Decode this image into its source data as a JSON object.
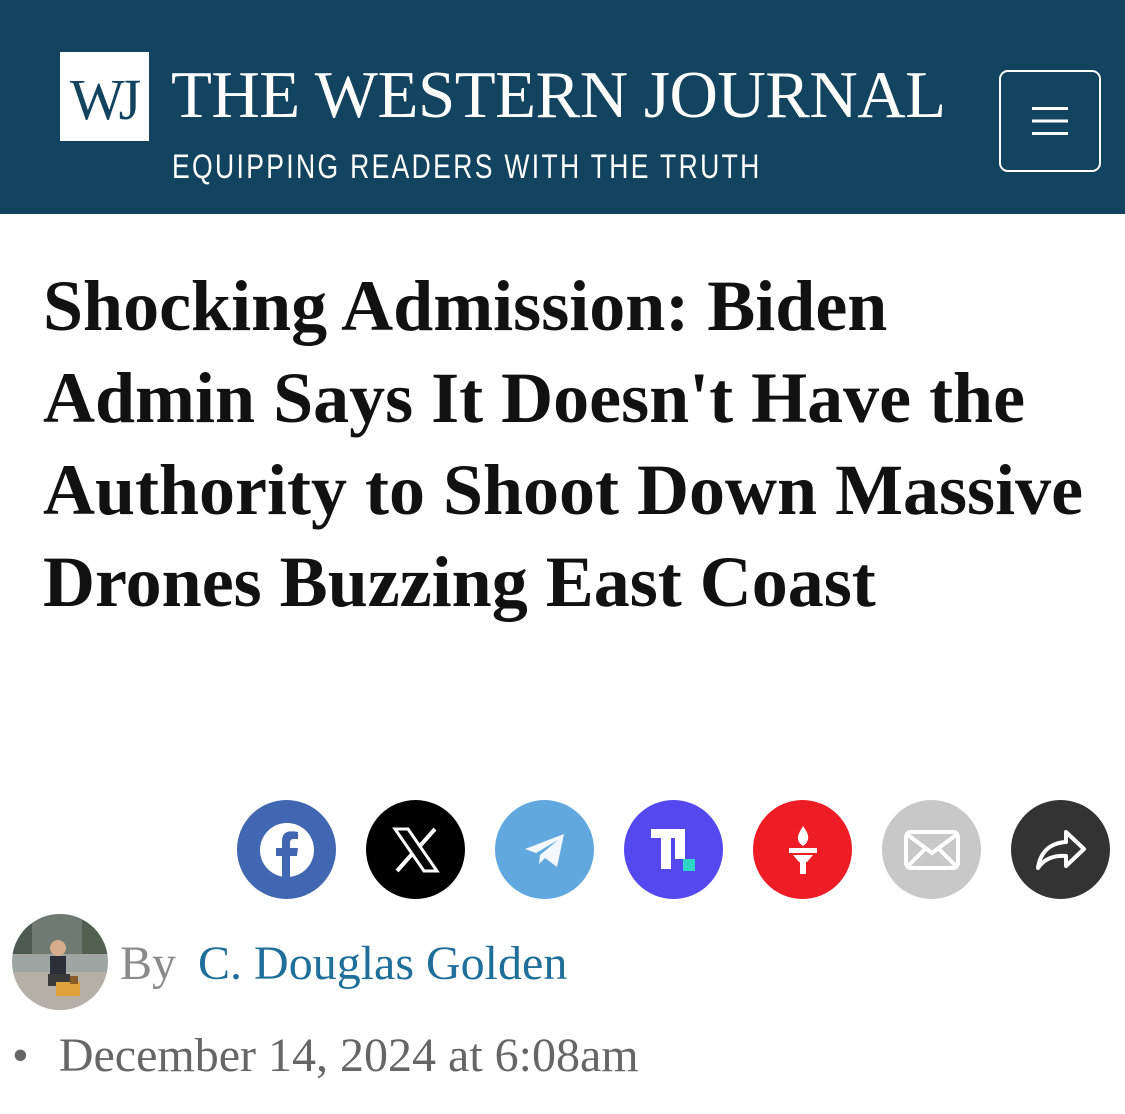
{
  "header": {
    "logo_text": "WJ",
    "site_title": "THE WESTERN JOURNAL",
    "tagline": "EQUIPPING READERS WITH THE TRUTH",
    "menu_icon": "hamburger-menu-icon",
    "background_color": "#12435f"
  },
  "article": {
    "headline": "Shocking Admission: Biden Admin Says It Doesn't Have the Authority to Shoot Down Massive Drones Buzzing East Coast",
    "by_label": "By",
    "author": "C. Douglas Golden",
    "bullet": "•",
    "date": "December 14, 2024 at 6:08am"
  },
  "share": [
    {
      "name": "facebook",
      "icon": "facebook-icon",
      "color": "#4267b2"
    },
    {
      "name": "x",
      "icon": "x-icon",
      "color": "#000000"
    },
    {
      "name": "telegram",
      "icon": "telegram-icon",
      "color": "#61a8de"
    },
    {
      "name": "truth-social",
      "icon": "truth-social-icon",
      "color": "#5448ee"
    },
    {
      "name": "gettr",
      "icon": "gettr-torch-icon",
      "color": "#ee1c25"
    },
    {
      "name": "email",
      "icon": "envelope-icon",
      "color": "#c8c8c8"
    },
    {
      "name": "share",
      "icon": "share-arrow-icon",
      "color": "#333333"
    }
  ]
}
